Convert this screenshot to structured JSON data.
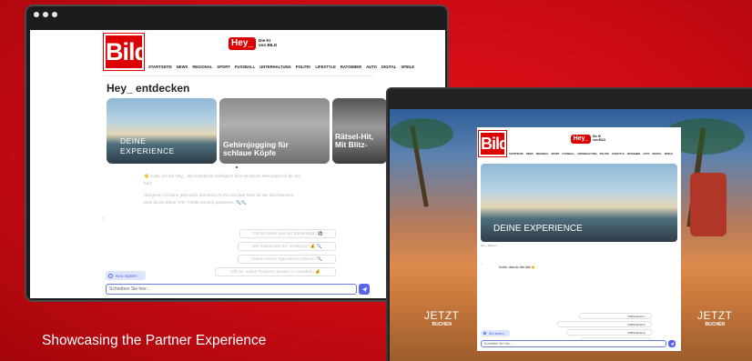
{
  "caption": "Showcasing the Partner Experience",
  "colors": {
    "brand_red": "#dd0000",
    "accent_blue": "#5b63e8",
    "frame": "#1c1c1e"
  },
  "desktop": {
    "bild_logo": "Bild",
    "hey_logo": "Hey_",
    "hey_tagline_1": "Die KI",
    "hey_tagline_2": "von BILD",
    "nav": [
      "STARTSEITE",
      "NEWS",
      "REGIONAL",
      "SPORT",
      "FUSSBALL",
      "UNTERHALTUNG",
      "POLITIK",
      "LIFESTYLE",
      "RATGEBER",
      "AUTO",
      "DIGITAL",
      "SPIELE"
    ],
    "section_title": "Hey_ entdecken",
    "cards": [
      {
        "caption_1": "DEINE",
        "caption_2": "EXPERIENCE"
      },
      {
        "caption_1": "Gehirnjogging für",
        "caption_2": "schlaue Köpfe"
      },
      {
        "caption_1": "Rätsel-Hit,",
        "caption_2": "Mit Blitz-"
      }
    ],
    "intro_1": "👋 Hallo, ich bin Hey_, die Künstliche Intelligenz (KI) von BILD. Was kann ich für Sie",
    "intro_2": "tun?",
    "intro_3": "Übrigens: Ich kann jetzt auch das BILD-Archiv und das Netz für Sie durchsuchen.",
    "intro_4": "Dies ist ein früher Test. Fehler können passieren. 🔍🔍",
    "suggestions": [
      "Gibt es News aus der Bundesliga? ⚽",
      "Wie funktioniert der Vorabzug? 💰 🔍",
      "Haben Wörter irgendeinen Zweck? 🔍",
      "Hilf mir, meine Finanzen besser zu verwalten 💰"
    ],
    "new_chat": "Neu starten",
    "input_placeholder": "Schreiben Sie hier..."
  },
  "partner": {
    "bild_logo": "Bild",
    "hey_logo": "Hey_",
    "hey_tagline_1": "Die KI",
    "hey_tagline_2": "von BILD",
    "nav": [
      "STARTSEITE",
      "NEWS",
      "REGIONAL",
      "SPORT",
      "FUSSBALL",
      "UNTERHALTUNG",
      "POLITIK",
      "LIFESTYLE",
      "RATGEBER",
      "AUTO",
      "DIGITAL",
      "SPIELE"
    ],
    "banner_caption": "DEINE EXPERIENCE",
    "banner_sub": "Hey_ Partner",
    "message": "Schön, dass du hier bist! 😊",
    "suggestions": [
      "VORSCHLAG 1",
      "VORSCHLAG 2",
      "VORSCHLAG 3",
      "VORSCHLAG 4"
    ],
    "new_chat": "Neu starten",
    "input_placeholder": "Schreiben Sie hier...",
    "cta_left_1": "JETZT",
    "cta_left_2": "BUCHEN",
    "cta_right_1": "JETZT",
    "cta_right_2": "BUCHEN"
  }
}
